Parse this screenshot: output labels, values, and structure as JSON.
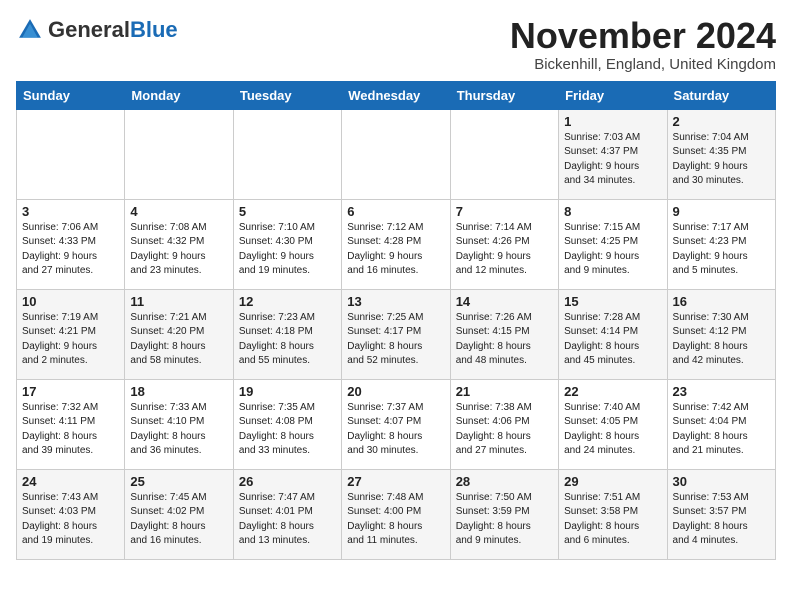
{
  "logo": {
    "general": "General",
    "blue": "Blue"
  },
  "header": {
    "month": "November 2024",
    "location": "Bickenhill, England, United Kingdom"
  },
  "weekdays": [
    "Sunday",
    "Monday",
    "Tuesday",
    "Wednesday",
    "Thursday",
    "Friday",
    "Saturday"
  ],
  "weeks": [
    [
      {
        "day": "",
        "info": ""
      },
      {
        "day": "",
        "info": ""
      },
      {
        "day": "",
        "info": ""
      },
      {
        "day": "",
        "info": ""
      },
      {
        "day": "",
        "info": ""
      },
      {
        "day": "1",
        "info": "Sunrise: 7:03 AM\nSunset: 4:37 PM\nDaylight: 9 hours\nand 34 minutes."
      },
      {
        "day": "2",
        "info": "Sunrise: 7:04 AM\nSunset: 4:35 PM\nDaylight: 9 hours\nand 30 minutes."
      }
    ],
    [
      {
        "day": "3",
        "info": "Sunrise: 7:06 AM\nSunset: 4:33 PM\nDaylight: 9 hours\nand 27 minutes."
      },
      {
        "day": "4",
        "info": "Sunrise: 7:08 AM\nSunset: 4:32 PM\nDaylight: 9 hours\nand 23 minutes."
      },
      {
        "day": "5",
        "info": "Sunrise: 7:10 AM\nSunset: 4:30 PM\nDaylight: 9 hours\nand 19 minutes."
      },
      {
        "day": "6",
        "info": "Sunrise: 7:12 AM\nSunset: 4:28 PM\nDaylight: 9 hours\nand 16 minutes."
      },
      {
        "day": "7",
        "info": "Sunrise: 7:14 AM\nSunset: 4:26 PM\nDaylight: 9 hours\nand 12 minutes."
      },
      {
        "day": "8",
        "info": "Sunrise: 7:15 AM\nSunset: 4:25 PM\nDaylight: 9 hours\nand 9 minutes."
      },
      {
        "day": "9",
        "info": "Sunrise: 7:17 AM\nSunset: 4:23 PM\nDaylight: 9 hours\nand 5 minutes."
      }
    ],
    [
      {
        "day": "10",
        "info": "Sunrise: 7:19 AM\nSunset: 4:21 PM\nDaylight: 9 hours\nand 2 minutes."
      },
      {
        "day": "11",
        "info": "Sunrise: 7:21 AM\nSunset: 4:20 PM\nDaylight: 8 hours\nand 58 minutes."
      },
      {
        "day": "12",
        "info": "Sunrise: 7:23 AM\nSunset: 4:18 PM\nDaylight: 8 hours\nand 55 minutes."
      },
      {
        "day": "13",
        "info": "Sunrise: 7:25 AM\nSunset: 4:17 PM\nDaylight: 8 hours\nand 52 minutes."
      },
      {
        "day": "14",
        "info": "Sunrise: 7:26 AM\nSunset: 4:15 PM\nDaylight: 8 hours\nand 48 minutes."
      },
      {
        "day": "15",
        "info": "Sunrise: 7:28 AM\nSunset: 4:14 PM\nDaylight: 8 hours\nand 45 minutes."
      },
      {
        "day": "16",
        "info": "Sunrise: 7:30 AM\nSunset: 4:12 PM\nDaylight: 8 hours\nand 42 minutes."
      }
    ],
    [
      {
        "day": "17",
        "info": "Sunrise: 7:32 AM\nSunset: 4:11 PM\nDaylight: 8 hours\nand 39 minutes."
      },
      {
        "day": "18",
        "info": "Sunrise: 7:33 AM\nSunset: 4:10 PM\nDaylight: 8 hours\nand 36 minutes."
      },
      {
        "day": "19",
        "info": "Sunrise: 7:35 AM\nSunset: 4:08 PM\nDaylight: 8 hours\nand 33 minutes."
      },
      {
        "day": "20",
        "info": "Sunrise: 7:37 AM\nSunset: 4:07 PM\nDaylight: 8 hours\nand 30 minutes."
      },
      {
        "day": "21",
        "info": "Sunrise: 7:38 AM\nSunset: 4:06 PM\nDaylight: 8 hours\nand 27 minutes."
      },
      {
        "day": "22",
        "info": "Sunrise: 7:40 AM\nSunset: 4:05 PM\nDaylight: 8 hours\nand 24 minutes."
      },
      {
        "day": "23",
        "info": "Sunrise: 7:42 AM\nSunset: 4:04 PM\nDaylight: 8 hours\nand 21 minutes."
      }
    ],
    [
      {
        "day": "24",
        "info": "Sunrise: 7:43 AM\nSunset: 4:03 PM\nDaylight: 8 hours\nand 19 minutes."
      },
      {
        "day": "25",
        "info": "Sunrise: 7:45 AM\nSunset: 4:02 PM\nDaylight: 8 hours\nand 16 minutes."
      },
      {
        "day": "26",
        "info": "Sunrise: 7:47 AM\nSunset: 4:01 PM\nDaylight: 8 hours\nand 13 minutes."
      },
      {
        "day": "27",
        "info": "Sunrise: 7:48 AM\nSunset: 4:00 PM\nDaylight: 8 hours\nand 11 minutes."
      },
      {
        "day": "28",
        "info": "Sunrise: 7:50 AM\nSunset: 3:59 PM\nDaylight: 8 hours\nand 9 minutes."
      },
      {
        "day": "29",
        "info": "Sunrise: 7:51 AM\nSunset: 3:58 PM\nDaylight: 8 hours\nand 6 minutes."
      },
      {
        "day": "30",
        "info": "Sunrise: 7:53 AM\nSunset: 3:57 PM\nDaylight: 8 hours\nand 4 minutes."
      }
    ]
  ]
}
